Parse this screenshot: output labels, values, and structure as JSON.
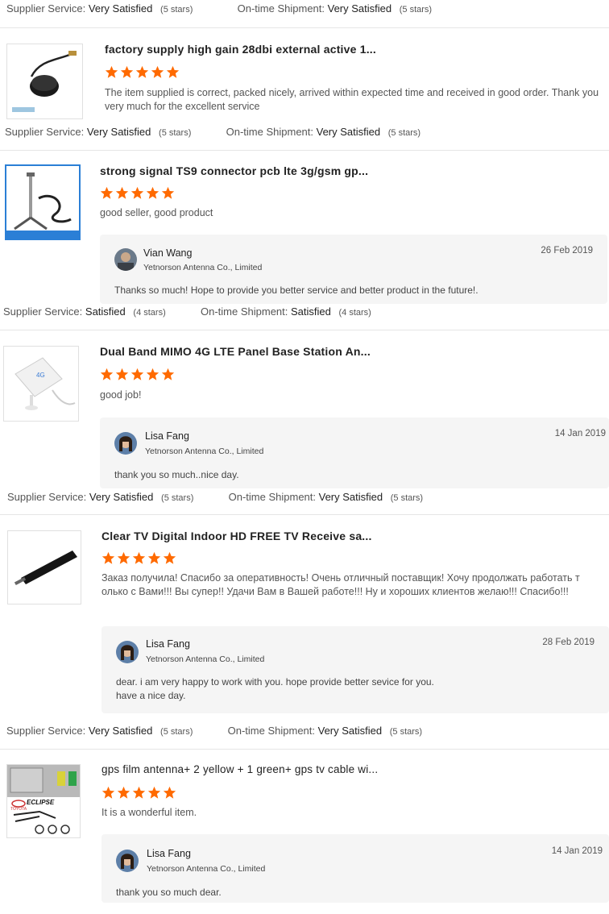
{
  "labels": {
    "supplier_service": "Supplier Service:",
    "ontime_shipment": "On-time Shipment:"
  },
  "colors": {
    "star": "#ff6a00",
    "reply_bg": "#f5f5f5"
  },
  "top_rating": {
    "supplier_value": "Very Satisfied",
    "supplier_stars": "(5 stars)",
    "shipment_value": "Very Satisfied",
    "shipment_stars": "(5 stars)"
  },
  "reviews": [
    {
      "product_title": "factory supply high gain 28dbi external active 1...",
      "stars": 5,
      "thumb_icon": "gps-antenna-puck-image",
      "text": "The item supplied is correct, packed nicely, arrived within expected time and received in good order. Thank you very much for the excellent service",
      "supplier_value": "Very Satisfied",
      "supplier_stars": "(5 stars)",
      "shipment_value": "Very Satisfied",
      "shipment_stars": "(5 stars)"
    },
    {
      "product_title": "strong signal TS9 connector pcb lte 3g/gsm gp...",
      "stars": 5,
      "thumb_icon": "magnetic-antenna-image",
      "text": "good seller, good product",
      "reply": {
        "name": "Vian Wang",
        "company": "Yetnorson Antenna Co., Limited",
        "date": "26 Feb 2019",
        "text": "Thanks so much! Hope to provide you better service and better product in the future!."
      },
      "supplier_value": "Satisfied",
      "supplier_stars": "(4 stars)",
      "shipment_value": "Satisfied",
      "shipment_stars": "(4 stars)"
    },
    {
      "product_title": "Dual Band MIMO 4G LTE Panel Base Station An...",
      "stars": 5,
      "thumb_icon": "panel-antenna-image",
      "text": "good job!",
      "reply": {
        "name": "Lisa Fang",
        "company": "Yetnorson Antenna Co., Limited",
        "date": "14 Jan 2019",
        "text": "thank you so much..nice day."
      },
      "supplier_value": "Very Satisfied",
      "supplier_stars": "(5 stars)",
      "shipment_value": "Very Satisfied",
      "shipment_stars": "(5 stars)"
    },
    {
      "product_title": "Clear TV Digital Indoor HD FREE TV Receive sa...",
      "stars": 5,
      "thumb_icon": "tv-antenna-stick-image",
      "text": "Заказ получила! Спасибо за оперативность! Очень отличный поставщик! Хочу продолжать  работать только с Вами!!! Вы супер!! Удачи Вам в Вашей работе!!! Ну и хороших клиентов желаю!!! Спасибо!!!",
      "reply": {
        "name": "Lisa Fang",
        "company": "Yetnorson Antenna Co., Limited",
        "date": "28 Feb 2019",
        "text_line1": "dear. i am very happy to work with you. hope provide better sevice for you.",
        "text_line2": "have a nice day."
      },
      "supplier_value": "Very Satisfied",
      "supplier_stars": "(5 stars)",
      "shipment_value": "Very Satisfied",
      "shipment_stars": "(5 stars)"
    },
    {
      "product_title": "gps film antenna+ 2 yellow + 1 green+ gps tv cable wi...",
      "stars": 5,
      "thumb_icon": "film-antenna-kit-image",
      "thumb_logo": "ECLIPSE",
      "thumb_brand": "TOYOTA",
      "text": "It is a wonderful item.",
      "reply": {
        "name": "Lisa Fang",
        "company": "Yetnorson Antenna Co., Limited",
        "date": "14 Jan 2019",
        "text": "thank you so much dear."
      }
    }
  ]
}
